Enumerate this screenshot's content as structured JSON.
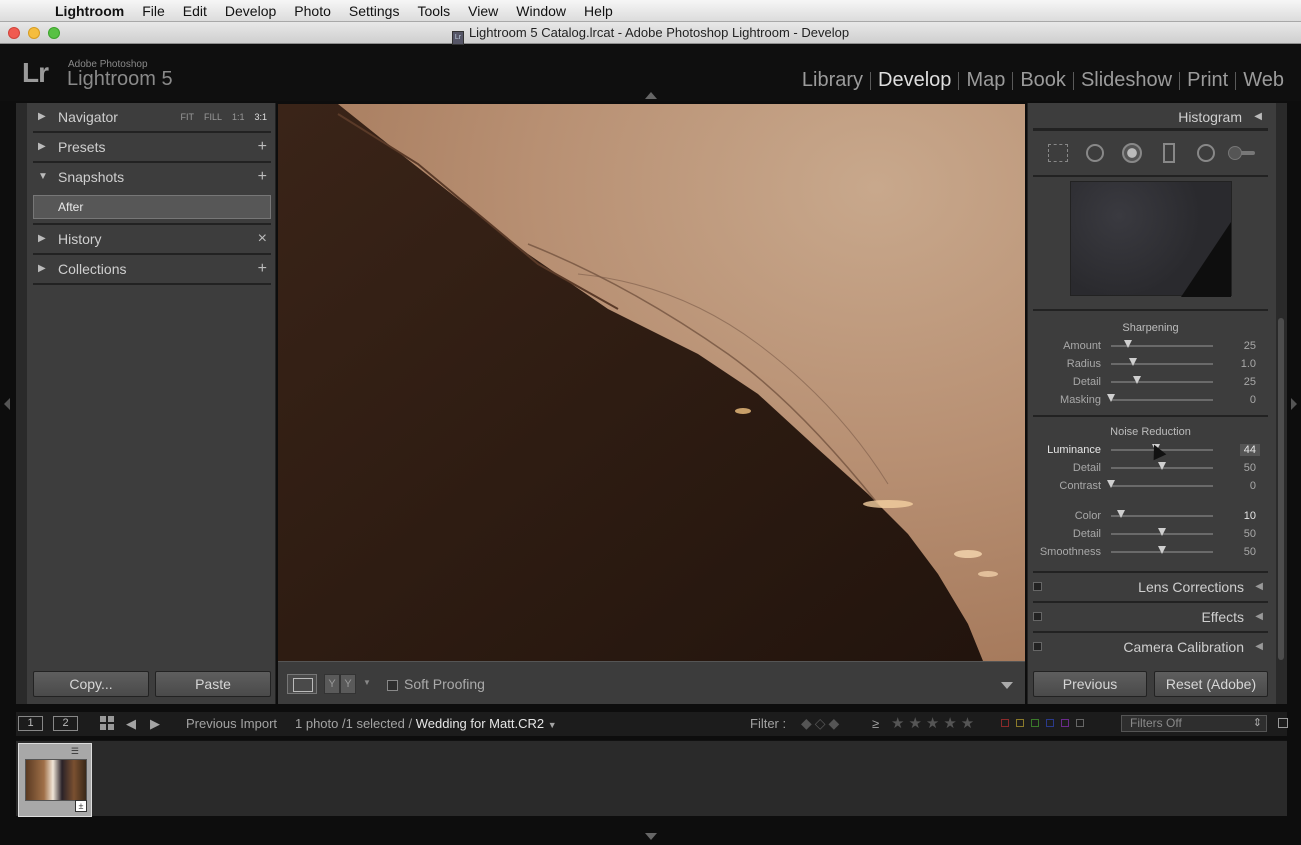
{
  "menubar": {
    "apple_icon": "apple-icon",
    "items": [
      "Lightroom",
      "File",
      "Edit",
      "Develop",
      "Photo",
      "Settings",
      "Tools",
      "View",
      "Window",
      "Help"
    ]
  },
  "window": {
    "title": "Lightroom 5 Catalog.lrcat - Adobe Photoshop Lightroom - Develop",
    "doc_icon_text": "Lr"
  },
  "header": {
    "logo": "Lr",
    "adobe_text": "Adobe Photoshop",
    "product": "Lightroom 5",
    "modules": [
      "Library",
      "Develop",
      "Map",
      "Book",
      "Slideshow",
      "Print",
      "Web"
    ],
    "active_module": "Develop"
  },
  "left_panel": {
    "navigator": {
      "label": "Navigator",
      "zoom": [
        "FIT",
        "FILL",
        "1:1",
        "3:1"
      ],
      "zoom_active": "3:1"
    },
    "presets": {
      "label": "Presets",
      "control": "+"
    },
    "snapshots": {
      "label": "Snapshots",
      "control": "+",
      "items": [
        "After"
      ]
    },
    "history": {
      "label": "History",
      "control": "×"
    },
    "collections": {
      "label": "Collections",
      "control": "+"
    },
    "copy_button": "Copy...",
    "paste_button": "Paste"
  },
  "toolbar": {
    "yy_labels": [
      "Y",
      "Y"
    ],
    "soft_proofing_label": "Soft Proofing",
    "soft_proofing_checked": false
  },
  "right_panel": {
    "histogram_label": "Histogram",
    "sharpening": {
      "title": "Sharpening",
      "sliders": [
        {
          "label": "Amount",
          "value": "25",
          "pos": 0.17
        },
        {
          "label": "Radius",
          "value": "1.0",
          "pos": 0.22
        },
        {
          "label": "Detail",
          "value": "25",
          "pos": 0.25
        },
        {
          "label": "Masking",
          "value": "0",
          "pos": 0.0
        }
      ]
    },
    "noise_reduction": {
      "title": "Noise Reduction",
      "luminance": [
        {
          "label": "Luminance",
          "value": "44",
          "pos": 0.44
        },
        {
          "label": "Detail",
          "value": "50",
          "pos": 0.5
        },
        {
          "label": "Contrast",
          "value": "0",
          "pos": 0.0
        }
      ],
      "color": [
        {
          "label": "Color",
          "value": "10",
          "pos": 0.1
        },
        {
          "label": "Detail",
          "value": "50",
          "pos": 0.5
        },
        {
          "label": "Smoothness",
          "value": "50",
          "pos": 0.5
        }
      ]
    },
    "sections": [
      "Lens Corrections",
      "Effects",
      "Camera Calibration"
    ],
    "previous_button": "Previous",
    "reset_button": "Reset (Adobe)"
  },
  "filmstrip_bar": {
    "page1": "1",
    "page2": "2",
    "source": "Previous Import",
    "count_text": "1 photo /1 selected /",
    "filename": "Wedding for Matt.CR2",
    "filter_label": "Filter :",
    "rating_op": "≥",
    "filter_select": "Filters Off"
  },
  "colors": {
    "accent": "#e6e6e6",
    "panel": "#3d3d3d",
    "label_colors": [
      "#8b2a2a",
      "#8b7a2a",
      "#3a7a2a",
      "#2a3a8b",
      "#6a2a8b",
      "#666666"
    ]
  }
}
